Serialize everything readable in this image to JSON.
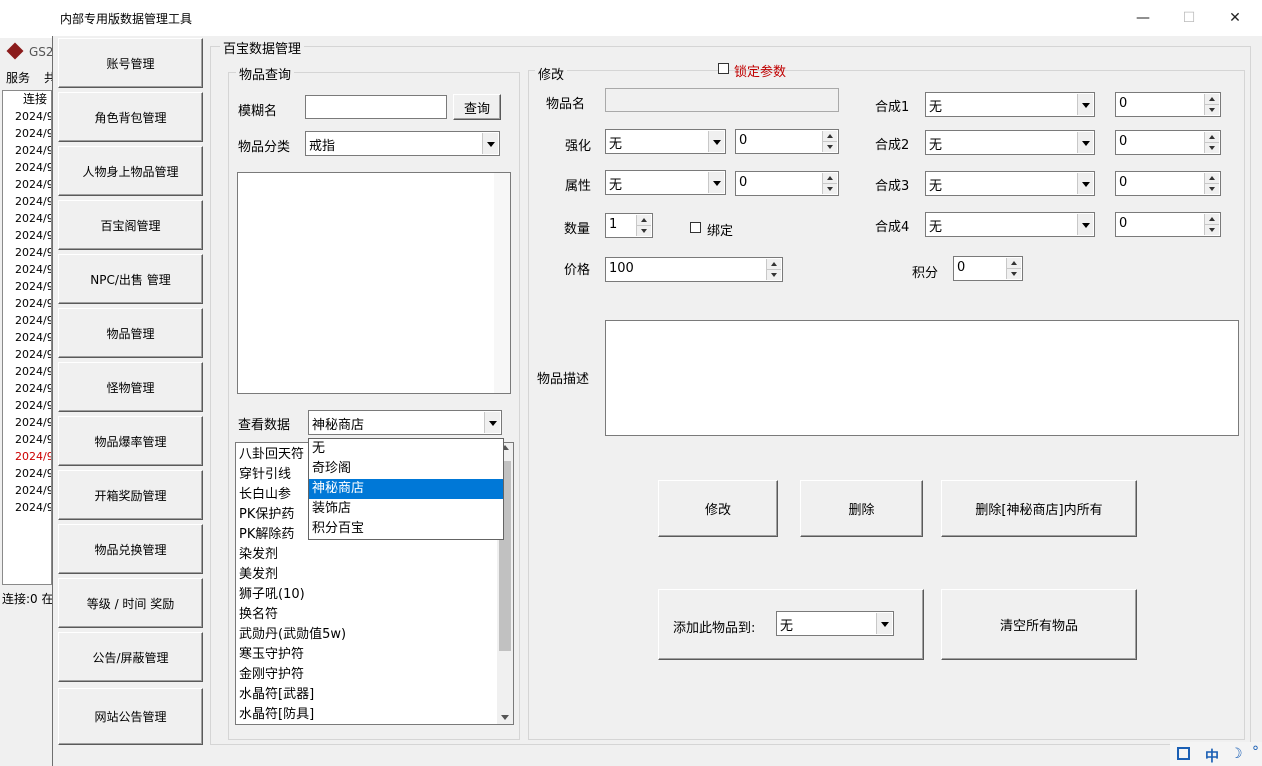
{
  "bg_window": {
    "title": "GS2",
    "menu": [
      "服务",
      "共"
    ],
    "log_header": "连接",
    "log_lines": [
      "2024/9/",
      "2024/9/",
      "2024/9/",
      "2024/9/",
      "2024/9/",
      "2024/9/",
      "2024/9/",
      "2024/9/",
      "2024/9/",
      "2024/9/",
      "2024/9/",
      "2024/9/",
      "2024/9/",
      "2024/9/",
      "2024/9/",
      "2024/9/",
      "2024/9/",
      "2024/9/",
      "2024/9/",
      "2024/9/",
      "2024/9/",
      "2024/9/",
      "2024/9/",
      "2024/9/"
    ],
    "log_line_colors": {
      "highlight_index": 20,
      "highlight": "#cc0000"
    },
    "status": "连接:0 在"
  },
  "window": {
    "title": "内部专用版数据管理工具",
    "minimize": "—",
    "maximize": "☐",
    "close": "✕"
  },
  "sidebar": [
    "账号管理",
    "角色背包管理",
    "人物身上物品管理",
    "百宝阁管理",
    "NPC/出售  管理",
    "物品管理",
    "怪物管理",
    "物品爆率管理",
    "开箱奖励管理",
    "物品兑换管理",
    "等级 / 时间 奖励",
    "公告/屏蔽管理",
    "网站公告管理"
  ],
  "main": {
    "group_title": "百宝数据管理",
    "query": {
      "title": "物品查询",
      "fuzzy_label": "模糊名",
      "fuzzy_value": "",
      "search_button": "查询",
      "category_label": "物品分类",
      "category_value": "戒指",
      "view_label": "查看数据",
      "view_value": "神秘商店",
      "view_options": [
        "无",
        "奇珍阁",
        "神秘商店",
        "装饰店",
        "积分百宝"
      ],
      "view_selected_index": 2,
      "items": [
        "八卦回天符",
        "穿针引线",
        "长白山参",
        "PK保护药",
        "PK解除药",
        "染发剂",
        "美发剂",
        "狮子吼(10)",
        "换名符",
        "武勋丹(武勋值5w)",
        "寒玉守护符",
        "金刚守护符",
        "水晶符[武器]",
        "水晶符[防具]"
      ]
    },
    "edit": {
      "title": "修改",
      "lock_label": "锁定参数",
      "lock_color": "#c00000",
      "item_name_label": "物品名",
      "item_name_value": "",
      "enhance_label": "强化",
      "enhance_value": "无",
      "enhance_num": "0",
      "attr_label": "属性",
      "attr_value": "无",
      "attr_num": "0",
      "qty_label": "数量",
      "qty_value": "1",
      "bind_label": "绑定",
      "price_label": "价格",
      "price_value": "100",
      "points_label": "积分",
      "points_value": "0",
      "synth": [
        {
          "label": "合成1",
          "value": "无",
          "num": "0"
        },
        {
          "label": "合成2",
          "value": "无",
          "num": "0"
        },
        {
          "label": "合成3",
          "value": "无",
          "num": "0"
        },
        {
          "label": "合成4",
          "value": "无",
          "num": "0"
        }
      ],
      "desc_label": "物品描述",
      "desc_value": "",
      "modify_button": "修改",
      "delete_button": "删除",
      "delete_all_button": "删除[神秘商店]内所有",
      "add_to_label": "添加此物品到:",
      "add_to_value": "无",
      "clear_button": "清空所有物品"
    }
  },
  "tray": {
    "ime": "中",
    "moon": "☽",
    "degree": "°"
  }
}
